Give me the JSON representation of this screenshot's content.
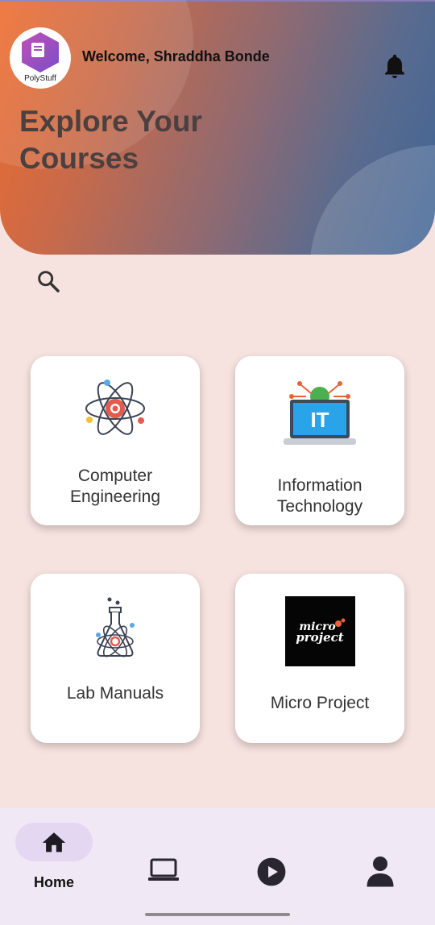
{
  "app": {
    "logo_text": "PolyStuff"
  },
  "header": {
    "welcome": "Welcome, Shraddha Bonde",
    "title_line1": "Explore Your",
    "title_line2": "Courses"
  },
  "search": {
    "icon": "search-icon"
  },
  "courses": [
    {
      "line1": "Computer",
      "line2": "Engineering",
      "icon": "atom-gear-icon"
    },
    {
      "line1": "Information",
      "line2": "Technology",
      "icon": "it-laptop-icon"
    },
    {
      "line1": "Lab Manuals",
      "icon": "flask-atom-icon"
    },
    {
      "line1": "Micro Project",
      "icon": "micro-project-logo",
      "logo_text": "micro project"
    }
  ],
  "nav": {
    "items": [
      {
        "label": "Home",
        "icon": "home-icon",
        "active": true
      },
      {
        "icon": "laptop-icon"
      },
      {
        "icon": "play-icon"
      },
      {
        "icon": "person-icon"
      }
    ]
  },
  "colors": {
    "background": "#f6e2de",
    "nav_bg": "#f1e8f5",
    "active_pill": "#e4d7f2"
  }
}
